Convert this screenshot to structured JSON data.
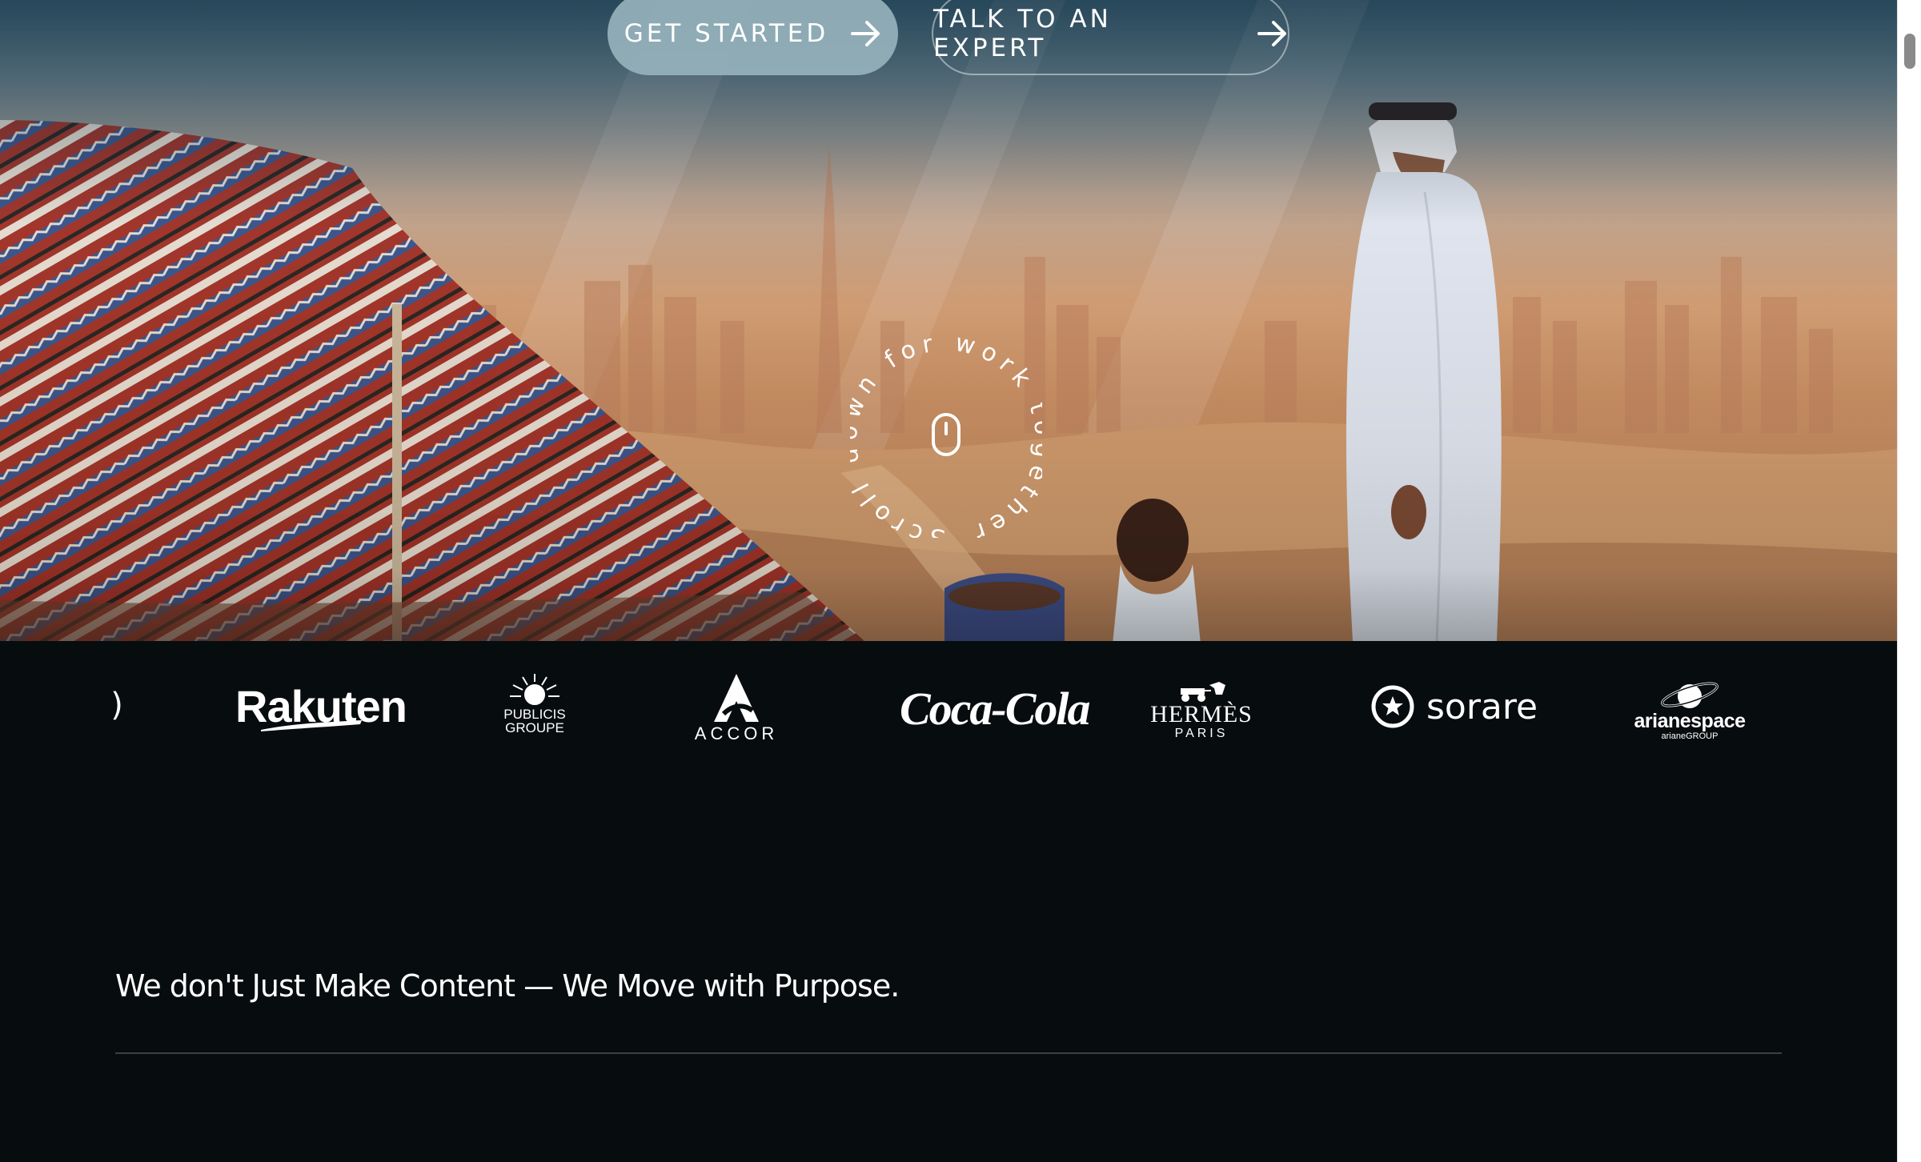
{
  "hero": {
    "buttons": {
      "primary_label": "GET STARTED",
      "secondary_label": "TALK TO AN EXPERT"
    },
    "scroll_badge_text": "Scroll down for work together ",
    "icons": [
      "arrow-right-icon",
      "mouse-icon"
    ]
  },
  "logos": {
    "partial": ")",
    "items": [
      {
        "name": "Rakuten",
        "text": "Rakuten"
      },
      {
        "name": "Publicis Groupe",
        "line1": "PUBLICIS",
        "line2": "GROUPE"
      },
      {
        "name": "Accor",
        "text": "ACCOR"
      },
      {
        "name": "Coca-Cola",
        "text": "Coca-Cola"
      },
      {
        "name": "Hermès",
        "line1": "HERMÈS",
        "line2": "PARIS"
      },
      {
        "name": "Sorare",
        "text": "sorare"
      },
      {
        "name": "Arianespace",
        "line1": "arianespace",
        "line2": "arianeGROUP"
      }
    ]
  },
  "section": {
    "headline": "We don't Just Make Content — We Move with Purpose."
  },
  "colors": {
    "page_background": "#070c0e",
    "primary_button": "#96b2bc",
    "text": "#ffffff",
    "divider": "#3a4043"
  }
}
